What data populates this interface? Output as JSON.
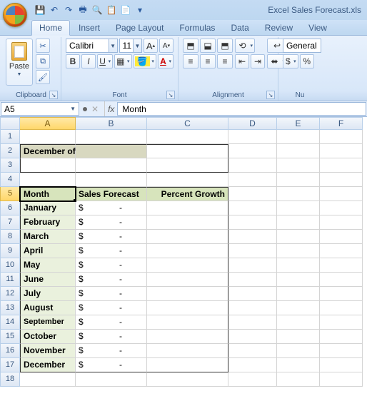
{
  "titlebar": {
    "filename": "Excel Sales Forecast.xls"
  },
  "qat": {
    "save": "💾",
    "undo": "↶",
    "redo": "↷",
    "print": "🖶",
    "preview": "🔍",
    "i6": "📋",
    "i7": "📄"
  },
  "tabs": [
    "Home",
    "Insert",
    "Page Layout",
    "Formulas",
    "Data",
    "Review",
    "View"
  ],
  "ribbon": {
    "clipboard": {
      "label": "Clipboard",
      "paste": "Paste"
    },
    "font": {
      "label": "Font",
      "name": "Calibri",
      "size": "11",
      "grow": "A",
      "shrink": "A",
      "bold": "B",
      "italic": "I",
      "underline": "U"
    },
    "alignment": {
      "label": "Alignment"
    },
    "number": {
      "label": "Nu",
      "format": "General"
    }
  },
  "namebox": "A5",
  "formula": "Month",
  "fx": "fx",
  "columns": [
    "A",
    "B",
    "C",
    "D",
    "E",
    "F"
  ],
  "sheet": {
    "r2_label": "December of Previous Year:",
    "headers": {
      "month": "Month",
      "forecast": "Sales Forecast",
      "growth": "Percent Growth"
    },
    "months": [
      "January",
      "February",
      "March",
      "April",
      "May",
      "June",
      "July",
      "August",
      "September",
      "October",
      "November",
      "December"
    ],
    "currency": "$",
    "dash": "-"
  }
}
